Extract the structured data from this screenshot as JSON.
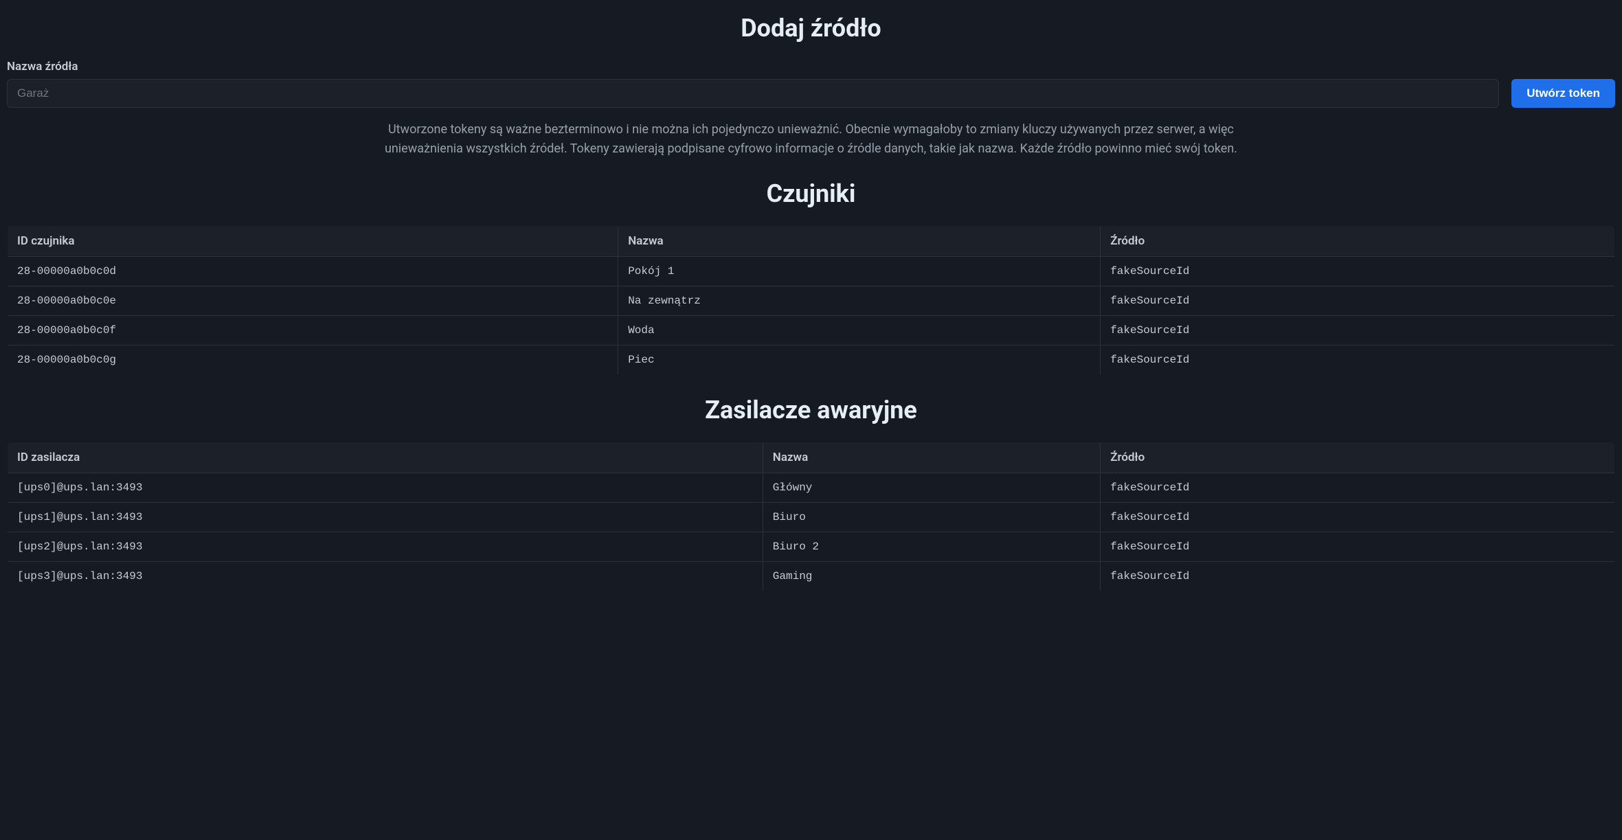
{
  "addSource": {
    "heading": "Dodaj źródło",
    "fieldLabel": "Nazwa źródła",
    "placeholder": "Garaż",
    "value": "",
    "buttonLabel": "Utwórz token",
    "description": "Utworzone tokeny są ważne bezterminowo i nie można ich pojedynczo unieważnić. Obecnie wymagałoby to zmiany kluczy używanych przez serwer, a więc unieważnienia wszystkich źródeł. Tokeny zawierają podpisane cyfrowo informacje o źródle danych, takie jak nazwa. Każde źródło powinno mieć swój token."
  },
  "sensors": {
    "heading": "Czujniki",
    "columns": [
      "ID czujnika",
      "Nazwa",
      "Źródło"
    ],
    "rows": [
      {
        "id": "28-00000a0b0c0d",
        "name": "Pokój 1",
        "source": "fakeSourceId"
      },
      {
        "id": "28-00000a0b0c0e",
        "name": "Na zewnątrz",
        "source": "fakeSourceId"
      },
      {
        "id": "28-00000a0b0c0f",
        "name": "Woda",
        "source": "fakeSourceId"
      },
      {
        "id": "28-00000a0b0c0g",
        "name": "Piec",
        "source": "fakeSourceId"
      }
    ]
  },
  "ups": {
    "heading": "Zasilacze awaryjne",
    "columns": [
      "ID zasilacza",
      "Nazwa",
      "Źródło"
    ],
    "rows": [
      {
        "id": "[ups0]@ups.lan:3493",
        "name": "Główny",
        "source": "fakeSourceId"
      },
      {
        "id": "[ups1]@ups.lan:3493",
        "name": "Biuro",
        "source": "fakeSourceId"
      },
      {
        "id": "[ups2]@ups.lan:3493",
        "name": "Biuro 2",
        "source": "fakeSourceId"
      },
      {
        "id": "[ups3]@ups.lan:3493",
        "name": "Gaming",
        "source": "fakeSourceId"
      }
    ]
  }
}
